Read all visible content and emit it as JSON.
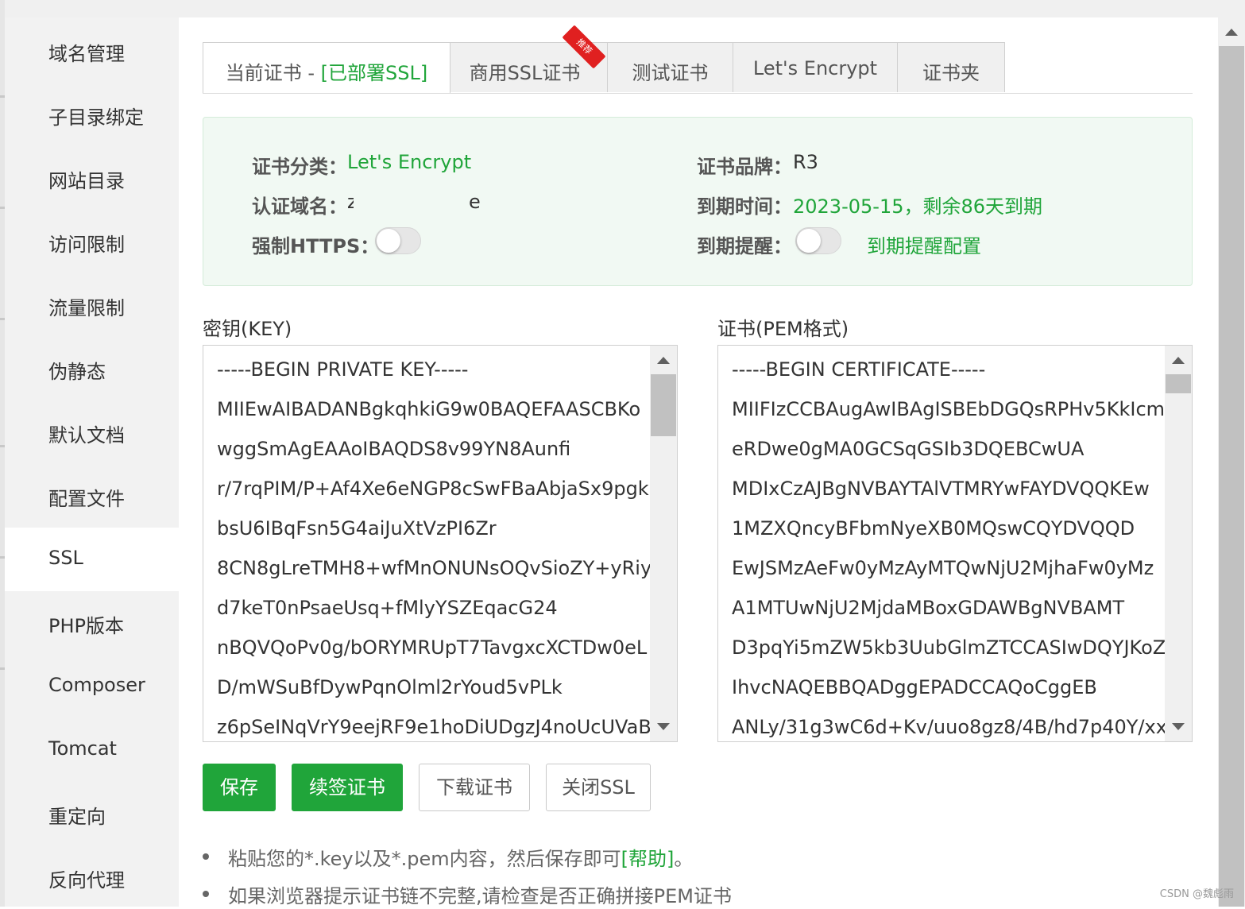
{
  "sidebar": {
    "items": [
      {
        "label": "域名管理"
      },
      {
        "label": "子目录绑定"
      },
      {
        "label": "网站目录"
      },
      {
        "label": "访问限制"
      },
      {
        "label": "流量限制"
      },
      {
        "label": "伪静态"
      },
      {
        "label": "默认文档"
      },
      {
        "label": "配置文件"
      },
      {
        "label": "SSL",
        "active": true
      },
      {
        "label": "PHP版本"
      },
      {
        "label": "Composer"
      },
      {
        "label": "Tomcat"
      },
      {
        "label": "重定向"
      },
      {
        "label": "反向代理"
      }
    ]
  },
  "tabs": {
    "current_prefix": "当前证书 - ",
    "current_status": "[已部署SSL]",
    "commercial": "商用SSL证书",
    "commercial_badge": "推荐",
    "test": "测试证书",
    "letsencrypt": "Let's Encrypt",
    "folder": "证书夹"
  },
  "cert_info": {
    "category_label": "证书分类：",
    "category_value": "Let's Encrypt",
    "brand_label": "证书品牌：",
    "brand_value": "R3",
    "domain_label": "认证域名：",
    "domain_value_start": "z",
    "domain_value_end": "e",
    "expiry_label": "到期时间：",
    "expiry_value": "2023-05-15，剩余86天到期",
    "force_https_label": "强制HTTPS：",
    "force_https_on": false,
    "reminder_label": "到期提醒：",
    "reminder_on": false,
    "reminder_config_link": "到期提醒配置"
  },
  "key_field": {
    "label": "密钥(KEY)",
    "lines": [
      "-----BEGIN PRIVATE KEY-----",
      "MIIEwAIBADANBgkqhkiG9w0BAQEFAASCBKo",
      "wggSmAgEAAoIBAQDS8v99YN8Aunfi",
      "r/7rqPIM/P+Af4Xe6eNGP8cSwFBaAbjaSx9pgk",
      "bsU6IBqFsn5G4aiJuXtVzPI6Zr",
      "8CN8gLreTMH8+wfMnONUNsOQvSioZY+yRiy",
      "d7keT0nPsaeUsq+fMlyYSZEqacG24",
      "nBQVQoPv0g/bORYMRUpT7TavgxcXCTDw0eL",
      "D/mWSuBfDywPqnOlml2rYoud5vPLk",
      "z6pSeINqVrY9eejRF9e1hoDiUDgzJ4noUcUVaB"
    ]
  },
  "cert_field": {
    "label": "证书(PEM格式)",
    "lines": [
      "-----BEGIN CERTIFICATE-----",
      "MIIFIzCCBAugAwIBAgISBEbDGQsRPHv5KkIcm",
      "eRDwe0gMA0GCSqGSIb3DQEBCwUA",
      "MDIxCzAJBgNVBAYTAlVTMRYwFAYDVQQKEw",
      "1MZXQncyBFbmNyeXB0MQswCQYDVQQD",
      "EwJSMzAeFw0yMzAyMTQwNjU2MjhaFw0yMz",
      "A1MTUwNjU2MjdaMBoxGDAWBgNVBAMT",
      "D3pqYi5mZW5kb3UubGlmZTCCASIwDQYJKoZ",
      "IhvcNAQEBBQADggEPADCCAQoCggEB",
      "ANLy/31g3wC6d+Kv/uuo8gz8/4B/hd7p40Y/xx"
    ]
  },
  "buttons": {
    "save": "保存",
    "renew": "续签证书",
    "download": "下载证书",
    "close_ssl": "关闭SSL"
  },
  "tips": {
    "tip1_text": "粘贴您的*.key以及*.pem内容，然后保存即可",
    "tip1_link": "[帮助]",
    "tip1_end": "。",
    "tip2_text": "如果浏览器提示证书链不完整,请检查是否正确拼接PEM证书"
  },
  "watermark": "CSDN @魏彪雨",
  "colors": {
    "accent": "#20a53a",
    "badge": "#e02020",
    "info_bg": "#f1f9f3"
  }
}
